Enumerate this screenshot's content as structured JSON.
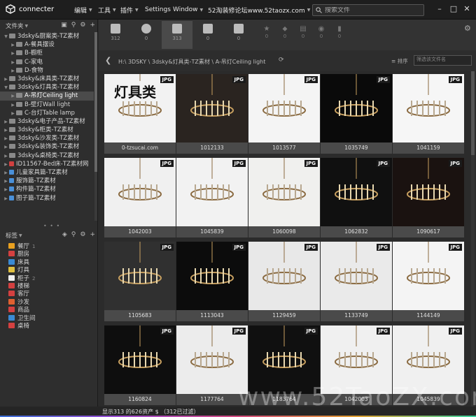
{
  "app": {
    "name": "connecter"
  },
  "menu": [
    {
      "label": "编辑",
      "has_caret": true
    },
    {
      "label": "工具",
      "has_caret": true
    },
    {
      "label": "插件",
      "has_caret": true
    },
    {
      "label": "Settings",
      "has_caret": false
    },
    {
      "label": "Window",
      "has_caret": true
    },
    {
      "label": "52淘装修论坛www.52taozx.com",
      "has_caret": true
    }
  ],
  "search": {
    "placeholder": "搜索文件"
  },
  "folders": {
    "title": "文件夹",
    "items": [
      {
        "label": "3dsky&厨案类-TZ素材",
        "level": 0,
        "expanded": true
      },
      {
        "label": "A-餐具摆设",
        "level": 1
      },
      {
        "label": "B-橱柜",
        "level": 1
      },
      {
        "label": "C-家电",
        "level": 1
      },
      {
        "label": "D-食物",
        "level": 1
      },
      {
        "label": "3dsky&床具类-TZ素材",
        "level": 0
      },
      {
        "label": "3dsky&灯具类-TZ素材",
        "level": 0,
        "expanded": true
      },
      {
        "label": "A-吊灯Ceiling light",
        "level": 1,
        "selected": true
      },
      {
        "label": "B-壁灯Wall light",
        "level": 1
      },
      {
        "label": "C-台灯Table lamp",
        "level": 1
      },
      {
        "label": "3dsky&电子产品-TZ素材",
        "level": 0
      },
      {
        "label": "3dsky&柜类-TZ素材",
        "level": 0
      },
      {
        "label": "3dsky&沙发类-TZ素材",
        "level": 0
      },
      {
        "label": "3dsky&装饰类-TZ素材",
        "level": 0
      },
      {
        "label": "3dsky&桌椅类-TZ素材",
        "level": 0
      },
      {
        "label": "ID11567-Bed床-TZ素材网",
        "level": 0,
        "color": "#d04040"
      },
      {
        "label": "儿童家具篇-TZ素材",
        "level": 0,
        "color": "#4a90d9"
      },
      {
        "label": "服饰篇-TZ素材",
        "level": 0,
        "color": "#4a90d9"
      },
      {
        "label": "构件篇-TZ素材",
        "level": 0,
        "color": "#4a90d9"
      },
      {
        "label": "图子篇-TZ素材",
        "level": 0,
        "color": "#4a90d9"
      }
    ]
  },
  "tags": {
    "title": "标签",
    "items": [
      {
        "label": "餐厅",
        "count": "1",
        "color": "#e8a020"
      },
      {
        "label": "厨房",
        "count": "",
        "color": "#d44040"
      },
      {
        "label": "床具",
        "count": "",
        "color": "#3a8ad4"
      },
      {
        "label": "灯具",
        "count": "",
        "color": "#e0c040"
      },
      {
        "label": "柜子",
        "count": "2",
        "color": "#f0f0f0"
      },
      {
        "label": "楼梯",
        "count": "",
        "color": "#d44040"
      },
      {
        "label": "客厅",
        "count": "",
        "color": "#d44040"
      },
      {
        "label": "沙发",
        "count": "",
        "color": "#e06030"
      },
      {
        "label": "商品",
        "count": "",
        "color": "#d44040"
      },
      {
        "label": "卫生间",
        "count": "",
        "color": "#3a8ad4"
      },
      {
        "label": "桌椅",
        "count": "",
        "color": "#d44040"
      }
    ]
  },
  "filter": {
    "big": [
      {
        "icon": "3d-box-icon",
        "count": "312"
      },
      {
        "icon": "circle-icon",
        "count": "0"
      },
      {
        "icon": "image-icon",
        "count": "313"
      },
      {
        "icon": "film-icon",
        "count": "0"
      },
      {
        "icon": "document-icon",
        "count": "0"
      }
    ],
    "small": [
      {
        "icon": "star-icon",
        "count": "0"
      },
      {
        "icon": "tag-icon",
        "count": "0"
      },
      {
        "icon": "grid-icon",
        "count": "0"
      },
      {
        "icon": "camera-icon",
        "count": "0"
      },
      {
        "icon": "more-icon",
        "count": "0"
      }
    ]
  },
  "breadcrumb": {
    "path": "H:\\ 3DSKY \\ 3dsky&灯具类-TZ素材 \\ A-吊灯Ceiling light",
    "sort_label": "排序",
    "filter_placeholder": "筛选该文件名"
  },
  "cards": [
    {
      "badge": "JPG",
      "caption": "0-tzsucai.com",
      "bg": "#f2f2f2",
      "overlay_text": "灯具类"
    },
    {
      "badge": "JPG",
      "caption": "1012133",
      "bg": "#2a2420"
    },
    {
      "badge": "JPG",
      "caption": "1013577",
      "bg": "#f4f4f4"
    },
    {
      "badge": "JPG",
      "caption": "1035749",
      "bg": "#0a0a0a"
    },
    {
      "badge": "JPG",
      "caption": "1041159",
      "bg": "#f6f6f6"
    },
    {
      "badge": "JPG",
      "caption": "1042003",
      "bg": "#f0f0f0"
    },
    {
      "badge": "JPG",
      "caption": "1045839",
      "bg": "#f2f2f2"
    },
    {
      "badge": "JPG",
      "caption": "1060098",
      "bg": "#f0f0ee"
    },
    {
      "badge": "JPG",
      "caption": "1062832",
      "bg": "#101010"
    },
    {
      "badge": "JPG",
      "caption": "1090617",
      "bg": "#1a1210"
    },
    {
      "badge": "JPG",
      "caption": "1105683",
      "bg": "#303030"
    },
    {
      "badge": "JPG",
      "caption": "1113043",
      "bg": "#0c0c0c"
    },
    {
      "badge": "JPG",
      "caption": "1129459",
      "bg": "#e8e8e8"
    },
    {
      "badge": "JPG",
      "caption": "1133749",
      "bg": "#eaeaea"
    },
    {
      "badge": "JPG",
      "caption": "1144149",
      "bg": "#f4f4f4"
    },
    {
      "badge": "JPG",
      "caption": "1160824",
      "bg": "#0e0e0e"
    },
    {
      "badge": "JPG",
      "caption": "1177764",
      "bg": "#ececec"
    },
    {
      "badge": "JPG",
      "caption": "1183764",
      "bg": "#101010"
    },
    {
      "badge": "JPG",
      "caption": "1042003",
      "bg": "#f0f0f0"
    },
    {
      "badge": "JPG",
      "caption": "1045839",
      "bg": "#f0f0f0"
    }
  ],
  "status": {
    "text": "显示313 的626资产 $ （312已过滤）"
  },
  "watermark": "www.52TaoZX.com"
}
